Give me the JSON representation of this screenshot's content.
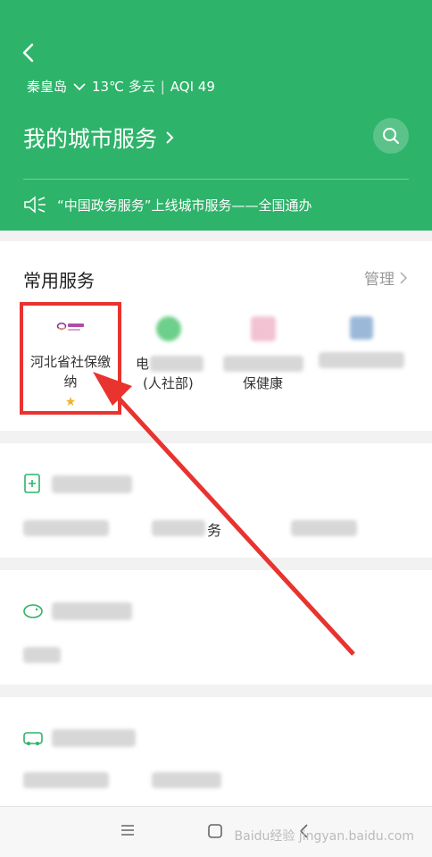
{
  "header": {
    "city": "秦皇岛",
    "weather": "13℃ 多云",
    "aqi": "AQI 49",
    "title": "我的城市服务",
    "notice": "“中国政务服务”上线城市服务——全国通办"
  },
  "common": {
    "title": "常用服务",
    "manage": "管理",
    "items": [
      {
        "label": "河北省社保缴纳",
        "starred": true
      },
      {
        "label": "电(人社部)"
      },
      {
        "label": "保健康"
      },
      {
        "label": ""
      }
    ],
    "visible_fragments": [
      "电",
      "(人社部)",
      "保健康"
    ]
  },
  "sec2": {
    "fragment": "务"
  },
  "watermark": "Baidu经验 jingyan.baidu.com",
  "colors": {
    "brand_green": "#2eb36a",
    "highlight_red": "#e8332f",
    "star": "#f0b323"
  }
}
